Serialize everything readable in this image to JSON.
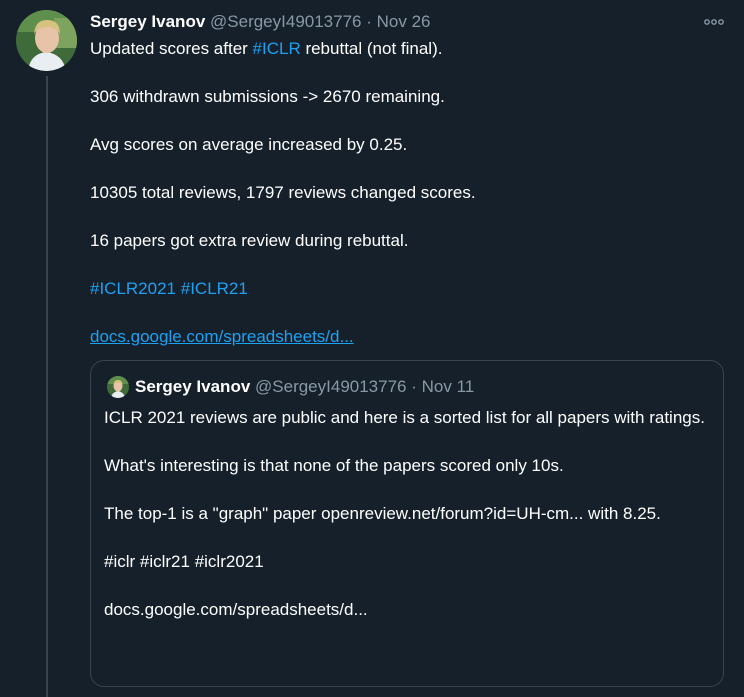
{
  "tweet": {
    "author_name": "Sergey Ivanov",
    "handle": "@SergeyI49013776",
    "separator": "·",
    "date": "Nov 26",
    "line1_pre": "Updated scores after ",
    "line1_hashtag": "#ICLR",
    "line1_post": " rebuttal (not final).",
    "para2": "306 withdrawn submissions -> 2670 remaining.",
    "para3": "Avg scores on average increased by 0.25.",
    "para4": "10305 total reviews, 1797 reviews changed scores.",
    "para5": "16 papers got extra review during rebuttal.",
    "hashtag1": "#ICLR2021",
    "hashtag2": "#ICLR21",
    "link": "docs.google.com/spreadsheets/d..."
  },
  "quoted_tweet": {
    "author_name": "Sergey Ivanov",
    "handle": "@SergeyI49013776",
    "separator": "·",
    "date": "Nov 11",
    "para1": "ICLR 2021 reviews are public and here is a sorted list for all papers with ratings.",
    "para2": "What's interesting is that none of the papers scored only 10s.",
    "para3": "The top-1 is a \"graph\" paper openreview.net/forum?id=UH-cm... with 8.25.",
    "para4": "#iclr #iclr21 #iclr2021",
    "para5": "docs.google.com/spreadsheets/d..."
  },
  "colors": {
    "background": "#15202b",
    "text": "#ffffff",
    "muted": "#8899a6",
    "accent": "#1da1f2",
    "border": "#38444d"
  },
  "icons": {
    "more": "more-horizontal-icon",
    "avatar": "profile-photo"
  }
}
